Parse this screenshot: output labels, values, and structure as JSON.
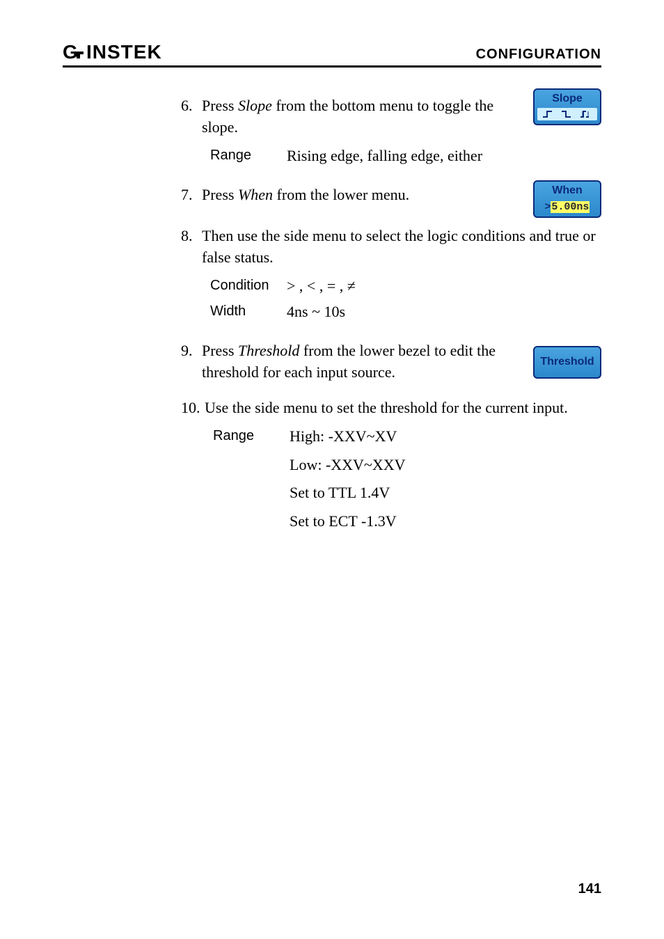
{
  "header": {
    "logo_text": "GW INSTEK",
    "section": "CONFIGURATION"
  },
  "steps": {
    "s6": {
      "num": "6.",
      "text_pre": "Press ",
      "text_em": "Slope",
      "text_post": " from the bottom menu to toggle the slope.",
      "button": {
        "line1": "Slope"
      },
      "sub": {
        "label": "Range",
        "value": "Rising edge, falling edge, either"
      }
    },
    "s7": {
      "num": "7.",
      "text_pre": "Press ",
      "text_em": "When",
      "text_post": " from the lower menu.",
      "button": {
        "line1": "When",
        "line2_prefix": ">",
        "line2_value": "5.00ns"
      }
    },
    "s8": {
      "num": "8.",
      "text": "Then use the side menu to select the logic conditions and true or false status.",
      "sub": [
        {
          "label": "Condition",
          "value": "> , < , = , ≠"
        },
        {
          "label": "Width",
          "value": "4ns ~ 10s"
        }
      ]
    },
    "s9": {
      "num": "9.",
      "text_pre": "Press ",
      "text_em": "Threshold",
      "text_post": " from the lower bezel to edit the threshold for each input source.",
      "button": {
        "line1": "Threshold"
      }
    },
    "s10": {
      "num": "10.",
      "text": "Use the side menu to set the threshold for the current input.",
      "sub_label": "Range",
      "sub_values": [
        "High: -XXV~XV",
        "Low: -XXV~XXV",
        "Set to TTL 1.4V",
        "Set to ECT -1.3V"
      ]
    }
  },
  "page_number": "141"
}
